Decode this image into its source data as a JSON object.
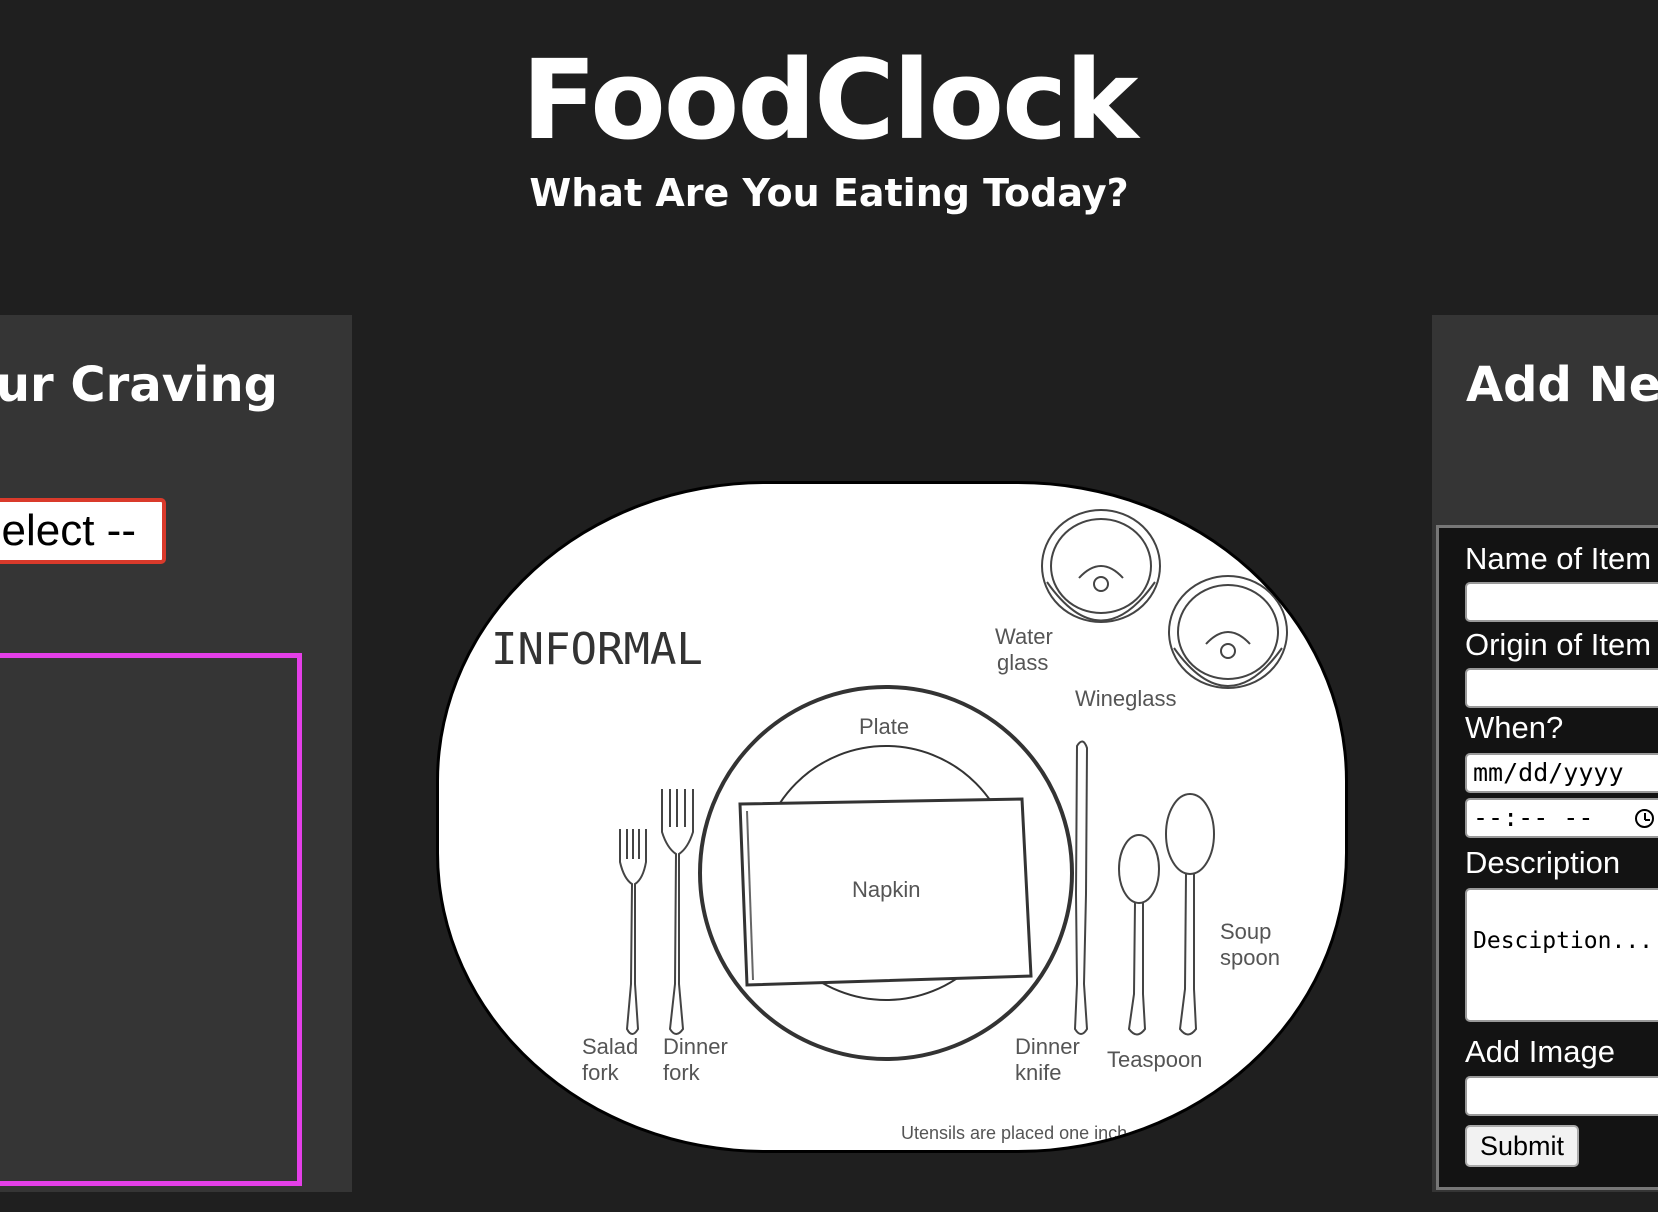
{
  "header": {
    "title": "FoodClock",
    "subtitle": "What Are You Eating Today?"
  },
  "left_panel": {
    "heading": "Your Craving",
    "select": {
      "selected": "-- Select --"
    }
  },
  "placemat": {
    "heading": "INFORMAL",
    "labels": {
      "water_glass_1": "Water",
      "water_glass_2": "glass",
      "wineglass": "Wineglass",
      "plate": "Plate",
      "napkin": "Napkin",
      "soup_spoon_1": "Soup",
      "soup_spoon_2": "spoon",
      "salad_fork_1": "Salad",
      "salad_fork_2": "fork",
      "dinner_fork_1": "Dinner",
      "dinner_fork_2": "fork",
      "dinner_knife_1": "Dinner",
      "dinner_knife_2": "knife",
      "teaspoon": "Teaspoon",
      "footnote": "Utensils are placed one inch"
    }
  },
  "right_panel": {
    "heading": "Add New",
    "form": {
      "name_label": "Name of Item",
      "origin_label": "Origin of Item",
      "when_label": "When?",
      "date_placeholder": "mm/dd/yyyy",
      "time_placeholder": "--:-- --",
      "description_label": "Description",
      "description_placeholder": "Desciption...",
      "image_label": "Add Image",
      "submit_label": "Submit"
    }
  }
}
